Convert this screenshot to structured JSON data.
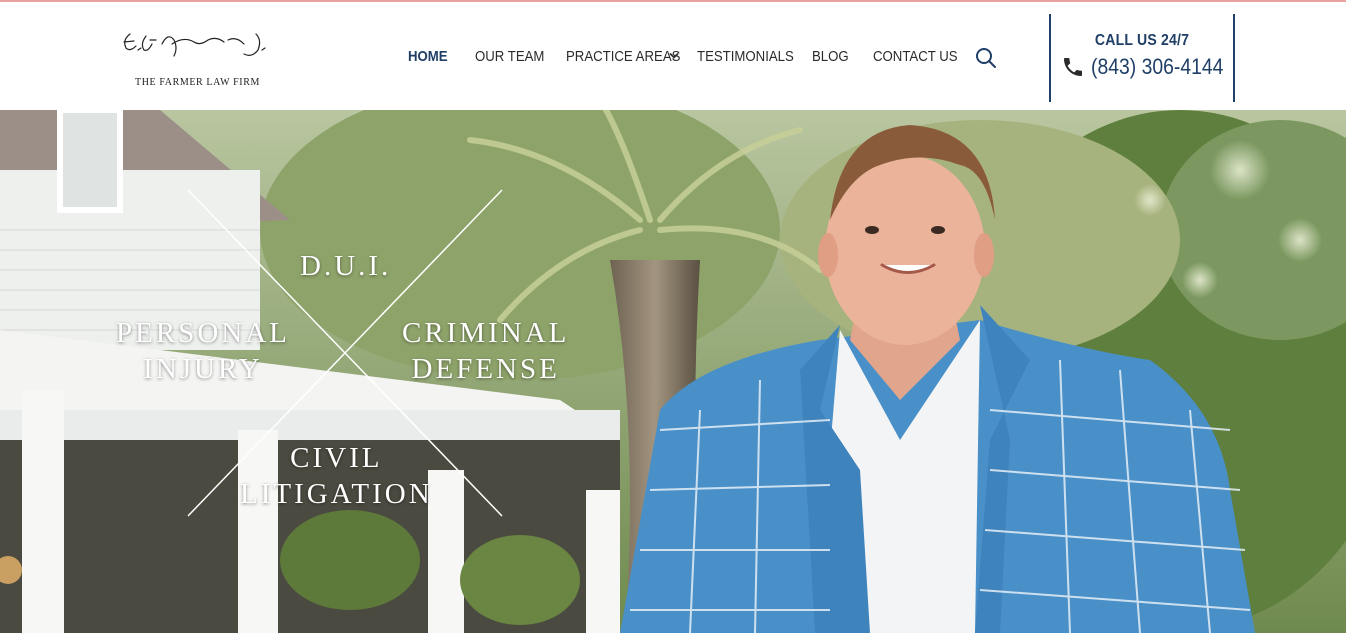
{
  "logo": {
    "firm_name": "THE FARMER LAW FIRM",
    "signature_text": "E. A. Farmer Jr."
  },
  "nav": {
    "items": [
      {
        "label": "HOME",
        "active": true
      },
      {
        "label": "OUR TEAM",
        "active": false
      },
      {
        "label": "PRACTICE AREAS",
        "active": false,
        "has_dropdown": true
      },
      {
        "label": "TESTIMONIALS",
        "active": false
      },
      {
        "label": "BLOG",
        "active": false
      },
      {
        "label": "CONTACT US",
        "active": false
      }
    ],
    "search_icon": "search-icon"
  },
  "call": {
    "label": "CALL US 24/7",
    "phone": "(843) 306-4144",
    "icon": "phone-icon"
  },
  "hero": {
    "practice_areas": {
      "top": "D.U.I.",
      "left_line1": "PERSONAL",
      "left_line2": "INJURY",
      "right_line1": "CRIMINAL",
      "right_line2": "DEFENSE",
      "bottom_line1": "CIVIL",
      "bottom_line2": "LITIGATION"
    }
  },
  "colors": {
    "brand_navy": "#1f3f66",
    "text_dark": "#2b2b2b",
    "top_rule": "#e8a0a0",
    "blazer_blue": "#4a90c8"
  }
}
